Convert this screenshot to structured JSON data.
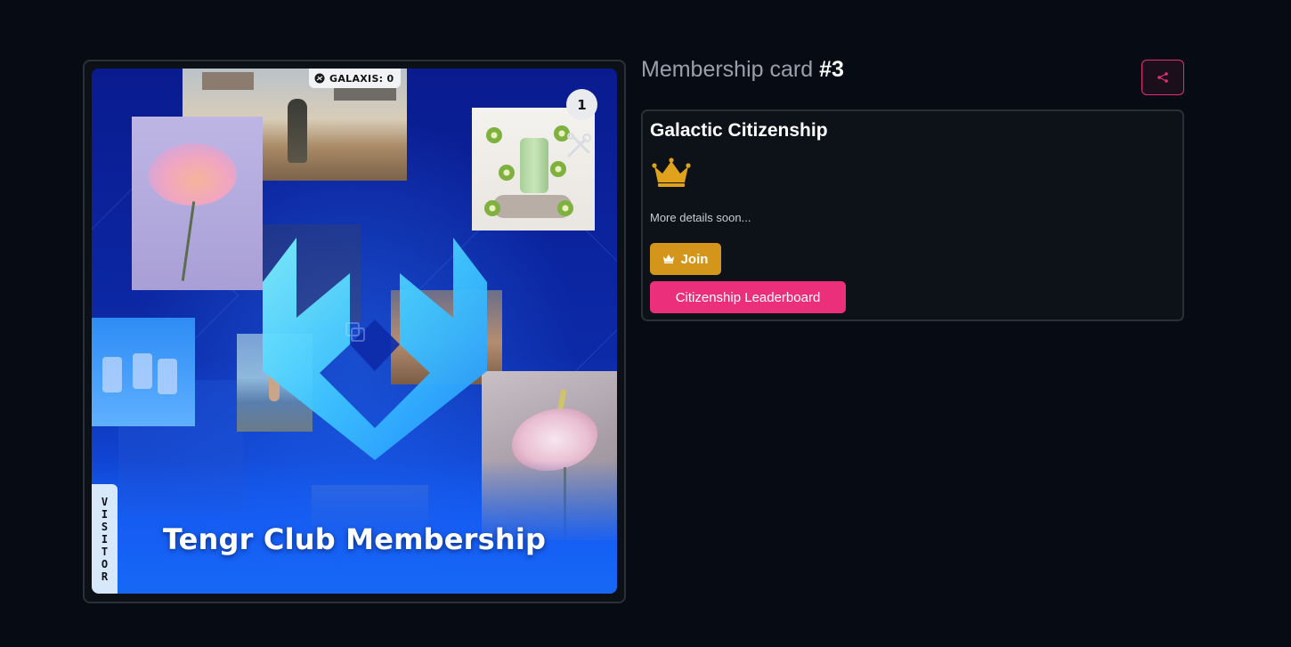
{
  "card": {
    "galaxis_label": "GALAXIS: 0",
    "counter": "1",
    "title": "Tengr Club Membership",
    "visitor_letters": [
      "V",
      "I",
      "S",
      "I",
      "T",
      "O",
      "R"
    ]
  },
  "header": {
    "title_prefix": "Membership card",
    "title_number": "#3"
  },
  "panel": {
    "title": "Galactic Citizenship",
    "description": "More details soon...",
    "join_label": "Join",
    "leaderboard_label": "Citizenship Leaderboard"
  },
  "colors": {
    "background": "#070b13",
    "accent_pink": "#ec2f7b",
    "accent_gold": "#d4961a",
    "card_blue": "#0c2aa8"
  },
  "icons": {
    "share": "share-icon",
    "crown": "crown-icon",
    "galaxis": "galaxis-icon"
  }
}
